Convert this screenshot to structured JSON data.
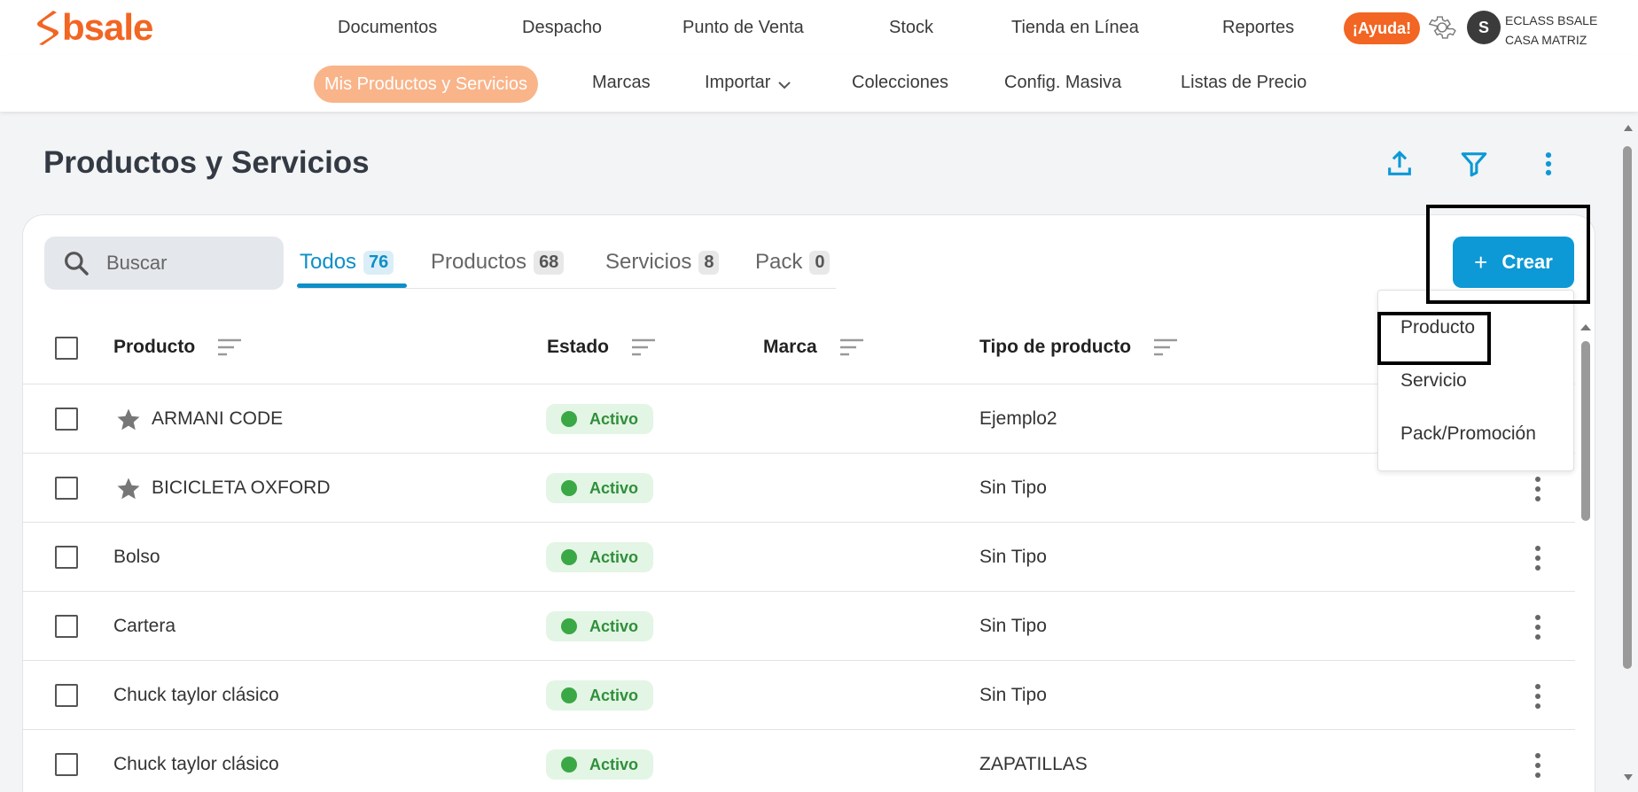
{
  "brand": {
    "name": "bsale",
    "color": "#f26522"
  },
  "main_nav": {
    "items": [
      "Documentos",
      "Despacho",
      "Punto de Venta",
      "Stock",
      "Tienda en Línea",
      "Reportes"
    ],
    "help_label": "¡Ayuda!",
    "avatar_initial": "S",
    "user_name": "ECLASS BSALE",
    "branch": "CASA MATRIZ"
  },
  "sub_nav": {
    "active": "Mis Productos y Servicios",
    "items": [
      "Marcas",
      "Importar",
      "Colecciones",
      "Config. Masiva",
      "Listas de Precio"
    ]
  },
  "page": {
    "title": "Productos y Servicios"
  },
  "search": {
    "placeholder": "Buscar"
  },
  "tabs": [
    {
      "label": "Todos",
      "count": "76",
      "active": true
    },
    {
      "label": "Productos",
      "count": "68"
    },
    {
      "label": "Servicios",
      "count": "8"
    },
    {
      "label": "Pack",
      "count": "0"
    }
  ],
  "create": {
    "label": "Crear",
    "menu": [
      "Producto",
      "Servicio",
      "Pack/Promoción"
    ]
  },
  "table": {
    "columns": [
      "Producto",
      "Estado",
      "Marca",
      "Tipo de producto"
    ],
    "rows": [
      {
        "name": "ARMANI CODE",
        "starred": true,
        "status": "Activo",
        "brand": "",
        "type": "Ejemplo2"
      },
      {
        "name": "BICICLETA OXFORD",
        "starred": true,
        "status": "Activo",
        "brand": "",
        "type": "Sin Tipo"
      },
      {
        "name": "Bolso",
        "starred": false,
        "status": "Activo",
        "brand": "",
        "type": "Sin Tipo"
      },
      {
        "name": "Cartera",
        "starred": false,
        "status": "Activo",
        "brand": "",
        "type": "Sin Tipo"
      },
      {
        "name": "Chuck taylor clásico",
        "starred": false,
        "status": "Activo",
        "brand": "",
        "type": "Sin Tipo"
      },
      {
        "name": "Chuck taylor clásico",
        "starred": false,
        "status": "Activo",
        "brand": "",
        "type": "ZAPATILLAS"
      }
    ]
  },
  "colors": {
    "accent": "#0d99d6",
    "active_tab": "#0d8fc7",
    "status_green": "#3aa845",
    "sub_active": "#f9b48a"
  }
}
